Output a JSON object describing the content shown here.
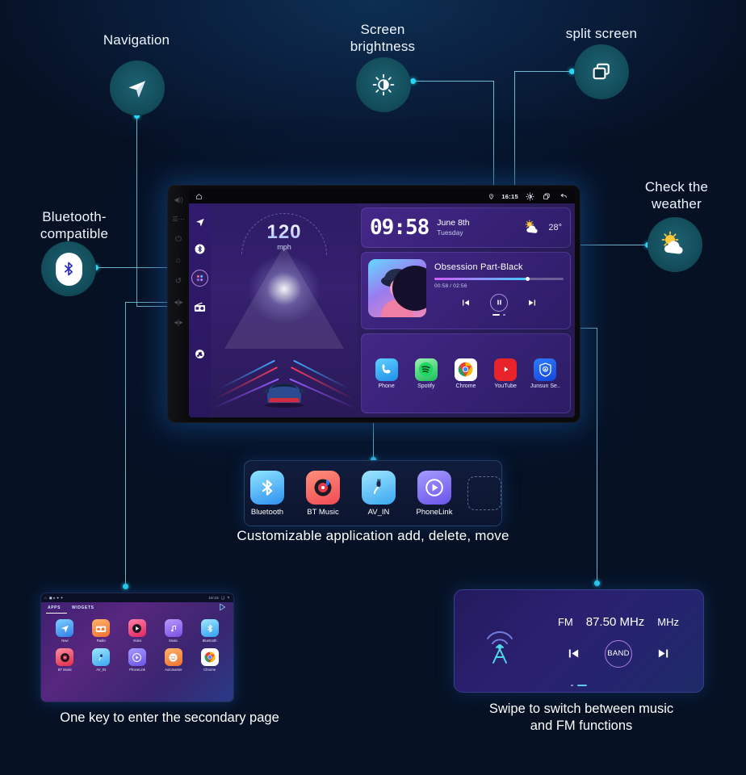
{
  "callouts": {
    "navigation": "Navigation",
    "screen_brightness": "Screen\nbrightness",
    "split_screen": "split screen",
    "bluetooth": "Bluetooth-\ncompatible",
    "weather": "Check the\nweather"
  },
  "headunit": {
    "status_bar": {
      "time": "16:15",
      "location_icon": "location-pin-icon",
      "brightness_icon": "brightness-icon",
      "split_icon": "split-screen-icon",
      "back_icon": "back-arrow-icon",
      "home_icon": "home-icon"
    },
    "bezel_buttons": [
      "mute-button",
      "menu-button",
      "power-button",
      "home-button",
      "back-button",
      "volume-down-button",
      "volume-up-button"
    ],
    "rail": [
      "navigation-icon",
      "bluetooth-icon",
      "apps-grid-icon",
      "radio-icon",
      "music-icon"
    ],
    "speedometer": {
      "value": "120",
      "unit": "mph"
    },
    "clock": {
      "time": "09:58",
      "date": "June 8th",
      "weekday": "Tuesday",
      "temperature": "28°",
      "weather_icon": "sun-cloud-icon"
    },
    "music": {
      "title": "Obsession Part-Black",
      "elapsed_total": "00:58 / 02:56",
      "progress_percent": 72,
      "prev_icon": "previous-track-icon",
      "play_icon": "pause-icon",
      "next_icon": "next-track-icon"
    },
    "apps": [
      {
        "label": "Phone",
        "icon": "phone-icon"
      },
      {
        "label": "Spotify",
        "icon": "spotify-icon"
      },
      {
        "label": "Chrome",
        "icon": "chrome-icon"
      },
      {
        "label": "YouTube",
        "icon": "youtube-icon"
      },
      {
        "label": "Junsun Se..",
        "icon": "junsun-service-icon"
      }
    ]
  },
  "dock": {
    "items": [
      {
        "label": "Bluetooth",
        "icon": "bluetooth-icon"
      },
      {
        "label": "BT Music",
        "icon": "bt-music-icon"
      },
      {
        "label": "AV_IN",
        "icon": "av-in-icon"
      },
      {
        "label": "PhoneLink",
        "icon": "phonelink-icon"
      }
    ],
    "empty_slot": "add-app-slot",
    "caption": "Customizable application add, delete, move"
  },
  "secondary_page": {
    "status_time": "16:15",
    "tabs": [
      "APPS",
      "WIDGETS"
    ],
    "play_store_icon": "play-store-icon",
    "apps": [
      {
        "label": "Navi",
        "icon": "navigation-icon"
      },
      {
        "label": "Radio",
        "icon": "radio-icon"
      },
      {
        "label": "Video",
        "icon": "video-icon"
      },
      {
        "label": "Music",
        "icon": "music-icon"
      },
      {
        "label": "Bluetooth",
        "icon": "bluetooth-icon"
      },
      {
        "label": "BT Music",
        "icon": "bt-music-icon"
      },
      {
        "label": "AV_IN",
        "icon": "av-in-icon"
      },
      {
        "label": "PhoneLink",
        "icon": "phonelink-icon"
      },
      {
        "label": "Automaster",
        "icon": "automaster-icon"
      },
      {
        "label": "Chrome",
        "icon": "chrome-icon"
      }
    ],
    "caption": "One key to enter the secondary page"
  },
  "fm_panel": {
    "antenna_icon": "radio-antenna-icon",
    "band": "FM",
    "frequency": "87.50 MHz",
    "unit": "MHz",
    "band_button": "BAND",
    "prev_icon": "seek-down-icon",
    "next_icon": "seek-up-icon",
    "caption": "Swipe to switch between music\nand FM functions"
  },
  "colors": {
    "background": "#061124",
    "accent_line": "#28d7f5",
    "bubble": "#14505e",
    "screen_purple": "#2d1c66"
  }
}
